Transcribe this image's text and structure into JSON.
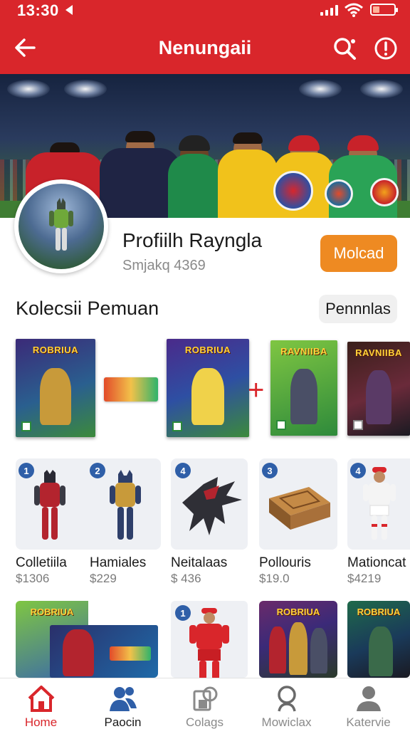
{
  "status_bar": {
    "time": "13:30"
  },
  "app_bar": {
    "title": "Nenungaii"
  },
  "profile": {
    "name": "Profiilh Rayngla",
    "subtitle": "Smjakq 4369",
    "action_label": "Molcad"
  },
  "collection": {
    "title": "Kolecsii Pemuan",
    "chip_label": "Pennnlas",
    "games": [
      "ROBRIUA",
      "ROBRIUA",
      "RAVNIIBA",
      "RAVNIIBA"
    ]
  },
  "products": [
    {
      "badge": "1",
      "name": "Colletiila",
      "price": "$1306"
    },
    {
      "badge": "2",
      "name": "Hamiales",
      "price": "$229"
    },
    {
      "badge": "4",
      "name": "Neitalaas",
      "price": "$ 436"
    },
    {
      "badge": "3",
      "name": "Pollouris",
      "price": "$19.0"
    },
    {
      "badge": "4",
      "name": "Mationcat",
      "price": "$4219"
    }
  ],
  "more_row": {
    "badge": "1",
    "box_title": "ROBRIUA"
  },
  "bottom_nav": [
    {
      "label": "Home",
      "icon": "home-icon",
      "active": true
    },
    {
      "label": "Paocin",
      "icon": "people-icon",
      "active": false
    },
    {
      "label": "Colags",
      "icon": "collection-icon",
      "active": false
    },
    {
      "label": "Mowiclax",
      "icon": "search-person-icon",
      "active": false
    },
    {
      "label": "Katervie",
      "icon": "profile-icon",
      "active": false
    }
  ],
  "colors": {
    "primary": "#d9262b",
    "action": "#ee8a22",
    "badge": "#2f5fa8"
  }
}
